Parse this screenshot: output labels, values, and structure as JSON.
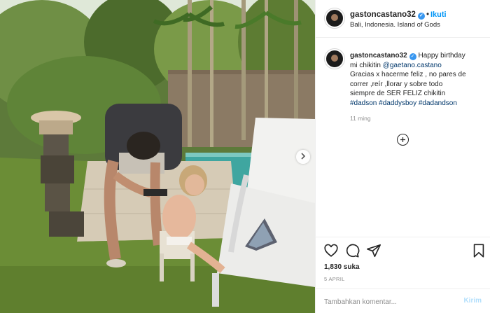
{
  "post": {
    "username": "gastoncastano32",
    "follow_label": "Ikuti",
    "location": "Bali, Indonesia. Island of Gods",
    "caption": {
      "username": "gastoncastano32",
      "line1": "Happy birthday",
      "line2_prefix": "mi chikitin ",
      "mention": "@gaetano.castano",
      "line3": "Gracias x hacerme feliz , no pares de",
      "line4": "correr ,reír ,llorar y sobre todo",
      "line5": "siempre de SER FELIZ chikitin",
      "hashtags": [
        "#dadson",
        "#daddysboy",
        "#dadandson"
      ]
    },
    "time_ago": "11 ming",
    "likes": "1,830 suka",
    "date": "5 APRIL",
    "comment_placeholder": "Tambahkan komentar...",
    "post_label": "Kirim"
  },
  "icons": {
    "verified": "verified-badge-icon",
    "more": "plus-circle-icon",
    "like": "heart-icon",
    "comment": "comment-icon",
    "share": "paper-plane-icon",
    "save": "bookmark-icon",
    "next": "chevron-right-icon"
  },
  "colors": {
    "accent": "#0095f6",
    "verified": "#3897f0",
    "hashtag": "#00376b",
    "muted": "#8e8e8e"
  }
}
